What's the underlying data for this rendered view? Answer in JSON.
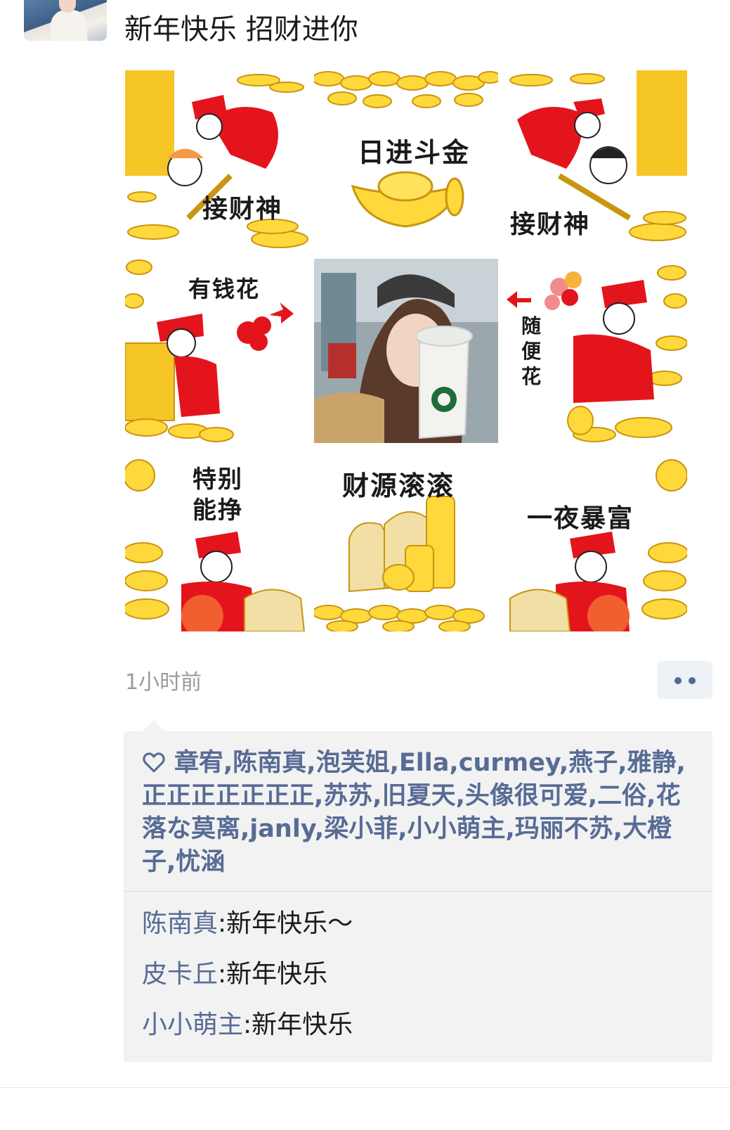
{
  "post": {
    "text": "新年快乐 招财进你",
    "time": "1小时前"
  },
  "grid": {
    "captions": {
      "top_left": "接财神",
      "top_middle": "日进斗金",
      "top_right": "接财神",
      "middle_left": "有钱花",
      "middle_right": "随便花",
      "bottom_left": "特别能挣",
      "bottom_middle": "财源滚滚",
      "bottom_right": "一夜暴富"
    }
  },
  "likes": {
    "icon": "heart-icon",
    "names": "章宥,陈南真,泡芙姐,Ella,curmey,燕子,雅静,正正正正正正正,苏苏,旧夏天,头像很可爱,二俗,花落な莫离,janly,梁小菲,小小萌主,玛丽不苏,大橙子,忧涵"
  },
  "comments": [
    {
      "author": "陈南真",
      "sep": ":",
      "text": "新年快乐～"
    },
    {
      "author": "皮卡丘",
      "sep": ":",
      "text": "新年快乐"
    },
    {
      "author": "小小萌主",
      "sep": ":",
      "text": "新年快乐"
    }
  ],
  "colors": {
    "link": "#576b95",
    "gold": "#f6c526",
    "red": "#e4141c",
    "panel": "#f2f2f2"
  }
}
